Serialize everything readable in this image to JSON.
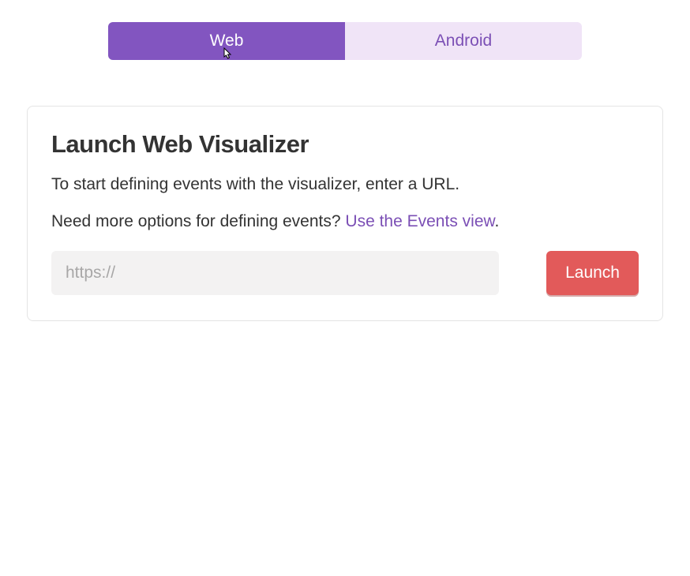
{
  "tabs": {
    "web": "Web",
    "android": "Android"
  },
  "card": {
    "title": "Launch Web Visualizer",
    "subtitle": "To start defining events with the visualizer, enter a URL.",
    "prompt_prefix": "Need more options for defining events? ",
    "prompt_link": "Use the Events view",
    "prompt_suffix": ".",
    "url_placeholder": "https://",
    "url_value": "",
    "launch_label": "Launch"
  }
}
